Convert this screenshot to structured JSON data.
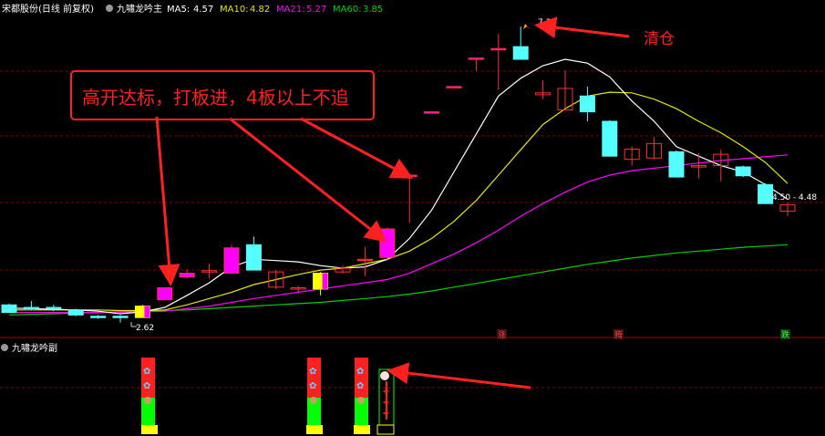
{
  "header": {
    "stock": "宋都股份(日线 前复权)",
    "indicator": "九嘯龙吟主",
    "ma5_label": "MA5:",
    "ma5_value": "4.57",
    "ma10_label": "MA10:",
    "ma10_value": "4.82",
    "ma21_label": "MA21:",
    "ma21_value": "5.27",
    "ma60_label": "MA60:",
    "ma60_value": "3.85"
  },
  "sub_header": {
    "indicator": "九嘯龙吟副"
  },
  "annotations": {
    "main_text": "高开达标，打板进，4板以上不追",
    "sell_text": "清仓",
    "high_label": "7.30",
    "low_label": "2.62",
    "last_label": "4.50 - 4.48",
    "mark_zhang": "涨",
    "mark_teng": "腾",
    "mark_die": "跌"
  },
  "colors": {
    "ma5": "#ffffff",
    "ma10": "#e6e600",
    "ma21": "#ff00ff",
    "ma60": "#00d000",
    "up": "#ff3030",
    "down": "#54ffff",
    "annot": "#ff2020"
  },
  "chart_data": {
    "type": "candlestick",
    "title": "宋都股份(日线 前复权)",
    "ylim": [
      2.5,
      7.4
    ],
    "candles": [
      {
        "o": 2.9,
        "h": 2.92,
        "l": 2.78,
        "c": 2.78,
        "t": "d"
      },
      {
        "o": 2.86,
        "h": 2.96,
        "l": 2.82,
        "c": 2.86,
        "t": "d"
      },
      {
        "o": 2.86,
        "h": 2.9,
        "l": 2.8,
        "c": 2.84,
        "t": "d"
      },
      {
        "o": 2.82,
        "h": 2.84,
        "l": 2.72,
        "c": 2.74,
        "t": "d"
      },
      {
        "o": 2.72,
        "h": 2.74,
        "l": 2.68,
        "c": 2.7,
        "t": "d"
      },
      {
        "o": 2.72,
        "h": 2.74,
        "l": 2.62,
        "c": 2.72,
        "t": "d"
      },
      {
        "o": 2.7,
        "h": 2.9,
        "l": 2.7,
        "c": 2.88,
        "t": "y"
      },
      {
        "o": 2.98,
        "h": 3.17,
        "l": 2.98,
        "c": 3.17,
        "t": "m"
      },
      {
        "o": 3.4,
        "h": 3.46,
        "l": 3.32,
        "c": 3.34,
        "t": "m"
      },
      {
        "o": 3.42,
        "h": 3.55,
        "l": 3.32,
        "c": 3.44,
        "t": "u"
      },
      {
        "o": 3.4,
        "h": 3.85,
        "l": 3.4,
        "c": 3.8,
        "t": "m"
      },
      {
        "o": 3.85,
        "h": 3.98,
        "l": 3.45,
        "c": 3.45,
        "t": "d"
      },
      {
        "o": 3.42,
        "h": 3.45,
        "l": 3.15,
        "c": 3.18,
        "t": "u"
      },
      {
        "o": 3.17,
        "h": 3.2,
        "l": 3.1,
        "c": 3.15,
        "t": "u"
      },
      {
        "o": 3.15,
        "h": 3.42,
        "l": 3.05,
        "c": 3.4,
        "t": "y"
      },
      {
        "o": 3.42,
        "h": 3.52,
        "l": 3.4,
        "c": 3.48,
        "t": "u"
      },
      {
        "o": 3.6,
        "h": 3.82,
        "l": 3.35,
        "c": 3.62,
        "t": "r"
      },
      {
        "o": 3.65,
        "h": 4.12,
        "l": 3.6,
        "c": 4.1,
        "t": "m"
      },
      {
        "o": 4.95,
        "h": 4.95,
        "l": 4.2,
        "c": 4.95,
        "t": "m"
      },
      {
        "o": 5.95,
        "h": 5.96,
        "l": 5.94,
        "c": 5.95,
        "t": "m"
      },
      {
        "o": 6.35,
        "h": 6.36,
        "l": 6.34,
        "c": 6.35,
        "t": "m"
      },
      {
        "o": 6.8,
        "h": 6.8,
        "l": 6.6,
        "c": 6.8,
        "t": "m"
      },
      {
        "o": 6.95,
        "h": 7.18,
        "l": 6.3,
        "c": 6.95,
        "t": "m"
      },
      {
        "o": 6.98,
        "h": 7.3,
        "l": 6.8,
        "c": 6.78,
        "t": "d"
      },
      {
        "o": 6.25,
        "h": 6.45,
        "l": 6.15,
        "c": 6.22,
        "t": "u"
      },
      {
        "o": 5.98,
        "h": 6.6,
        "l": 5.98,
        "c": 6.32,
        "t": "u"
      },
      {
        "o": 6.2,
        "h": 6.35,
        "l": 5.8,
        "c": 5.95,
        "t": "d"
      },
      {
        "o": 5.8,
        "h": 5.82,
        "l": 5.25,
        "c": 5.25,
        "t": "d"
      },
      {
        "o": 5.2,
        "h": 5.4,
        "l": 5.1,
        "c": 5.36,
        "t": "u"
      },
      {
        "o": 5.22,
        "h": 5.55,
        "l": 5.2,
        "c": 5.45,
        "t": "u"
      },
      {
        "o": 5.32,
        "h": 5.34,
        "l": 4.92,
        "c": 4.92,
        "t": "d"
      },
      {
        "o": 5.1,
        "h": 5.3,
        "l": 4.9,
        "c": 5.1,
        "t": "u"
      },
      {
        "o": 5.1,
        "h": 5.35,
        "l": 4.85,
        "c": 5.28,
        "t": "u"
      },
      {
        "o": 5.08,
        "h": 5.1,
        "l": 4.92,
        "c": 4.94,
        "t": "d"
      },
      {
        "o": 4.8,
        "h": 4.82,
        "l": 4.5,
        "c": 4.5,
        "t": "d"
      },
      {
        "o": 4.38,
        "h": 4.52,
        "l": 4.3,
        "c": 4.48,
        "t": "u"
      }
    ],
    "ma5": [
      2.85,
      2.84,
      2.83,
      2.82,
      2.8,
      2.76,
      2.79,
      2.86,
      3.05,
      3.25,
      3.5,
      3.62,
      3.6,
      3.58,
      3.52,
      3.48,
      3.5,
      3.62,
      3.95,
      4.4,
      5.0,
      5.6,
      6.2,
      6.48,
      6.68,
      6.78,
      6.72,
      6.5,
      6.12,
      5.8,
      5.4,
      5.25,
      5.1,
      5.0,
      4.8,
      4.57
    ],
    "ma10": [
      2.82,
      2.82,
      2.82,
      2.82,
      2.82,
      2.81,
      2.81,
      2.82,
      2.9,
      3.0,
      3.1,
      3.22,
      3.3,
      3.38,
      3.45,
      3.48,
      3.55,
      3.62,
      3.75,
      3.95,
      4.22,
      4.55,
      4.95,
      5.35,
      5.75,
      6.0,
      6.2,
      6.26,
      6.25,
      6.15,
      6.0,
      5.8,
      5.62,
      5.4,
      5.15,
      4.82
    ],
    "ma21": [
      2.78,
      2.78,
      2.78,
      2.78,
      2.78,
      2.78,
      2.79,
      2.8,
      2.84,
      2.88,
      2.94,
      3.0,
      3.05,
      3.1,
      3.15,
      3.2,
      3.25,
      3.3,
      3.4,
      3.55,
      3.7,
      3.88,
      4.08,
      4.3,
      4.5,
      4.68,
      4.84,
      4.95,
      5.02,
      5.06,
      5.1,
      5.14,
      5.18,
      5.21,
      5.24,
      5.27
    ],
    "ma60": [
      2.74,
      2.75,
      2.76,
      2.77,
      2.78,
      2.79,
      2.8,
      2.81,
      2.82,
      2.84,
      2.86,
      2.88,
      2.9,
      2.92,
      2.94,
      2.97,
      3.0,
      3.03,
      3.07,
      3.12,
      3.18,
      3.24,
      3.3,
      3.36,
      3.42,
      3.48,
      3.54,
      3.59,
      3.64,
      3.68,
      3.72,
      3.75,
      3.78,
      3.81,
      3.83,
      3.85
    ]
  }
}
